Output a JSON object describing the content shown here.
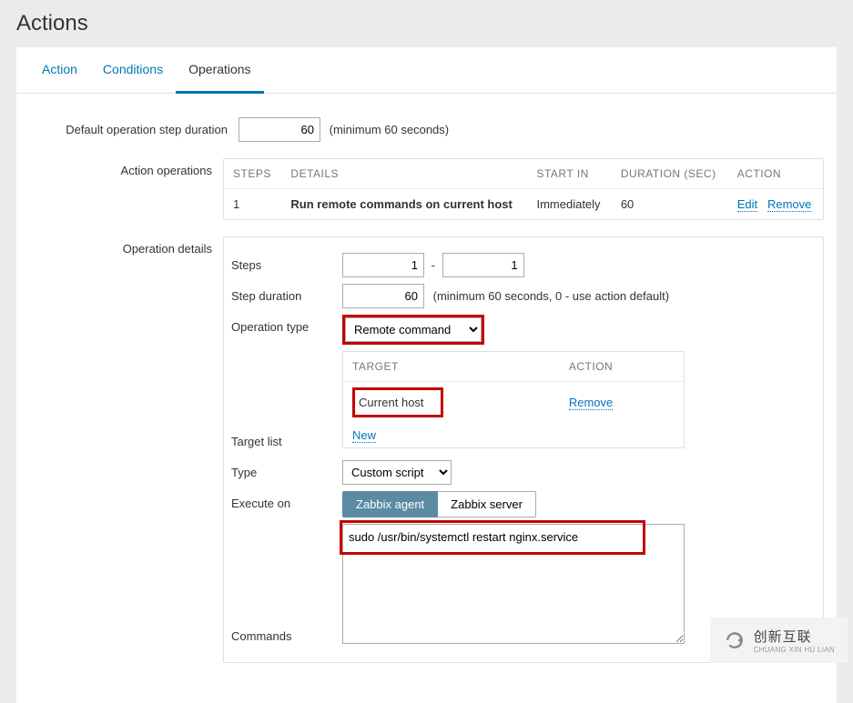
{
  "page": {
    "title": "Actions"
  },
  "tabs": {
    "action": "Action",
    "conditions": "Conditions",
    "operations": "Operations"
  },
  "form": {
    "default_duration_label": "Default operation step duration",
    "default_duration_value": "60",
    "default_duration_hint": "(minimum 60 seconds)",
    "action_operations_label": "Action operations",
    "operation_details_label": "Operation details"
  },
  "ops_table": {
    "headers": {
      "steps": "STEPS",
      "details": "DETAILS",
      "start": "START IN",
      "duration": "DURATION (SEC)",
      "action": "ACTION"
    },
    "rows": [
      {
        "steps": "1",
        "details": "Run remote commands on current host",
        "start": "Immediately",
        "duration": "60",
        "edit": "Edit",
        "remove": "Remove"
      }
    ]
  },
  "details": {
    "steps_label": "Steps",
    "step_from": "1",
    "step_to": "1",
    "step_duration_label": "Step duration",
    "step_duration_value": "60",
    "step_duration_hint": "(minimum 60 seconds, 0 - use action default)",
    "op_type_label": "Operation type",
    "op_type_value": "Remote command",
    "target_list_label": "Target list",
    "target_headers": {
      "target": "TARGET",
      "action": "ACTION"
    },
    "target_current": "Current host",
    "target_remove": "Remove",
    "target_new": "New",
    "type_label": "Type",
    "type_value": "Custom script",
    "execute_on_label": "Execute on",
    "execute_agent": "Zabbix agent",
    "execute_server": "Zabbix server",
    "commands_label": "Commands",
    "commands_value": "sudo /usr/bin/systemctl restart nginx.service"
  },
  "watermark": {
    "cn": "创新互联",
    "en": "CHUANG XIN HU LIAN"
  }
}
